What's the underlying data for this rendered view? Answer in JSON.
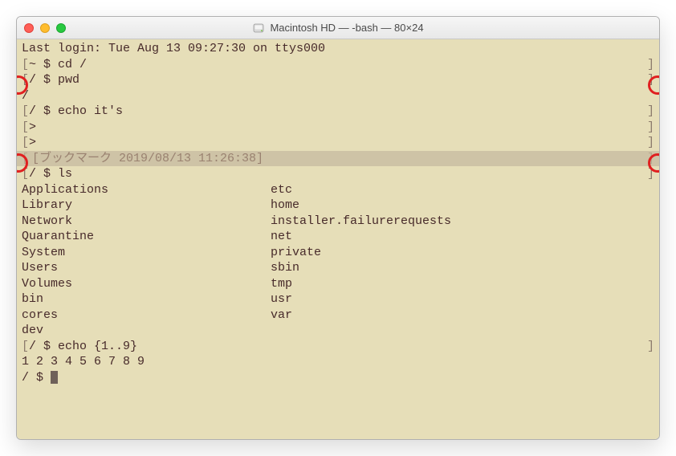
{
  "window": {
    "title": "Macintosh HD — -bash — 80×24"
  },
  "lines": {
    "last_login": "Last login: Tue Aug 13 09:27:30 on ttys000",
    "cd": "~ $ cd /",
    "pwd": "/ $ pwd",
    "pwd_out": "/",
    "echo1": "/ $ echo it's",
    "cont": ">",
    "bookmark": "[ブックマーク 2019/08/13 11:26:38]",
    "ls": "/ $ ls",
    "echo2": "/ $ echo {1..9}",
    "echo2_out": "1 2 3 4 5 6 7 8 9",
    "prompt": "/ $ "
  },
  "ls_output": {
    "col1": [
      "Applications",
      "Library",
      "Network",
      "Quarantine",
      "System",
      "Users",
      "Volumes",
      "bin",
      "cores",
      "dev"
    ],
    "col2": [
      "etc",
      "home",
      "installer.failurerequests",
      "net",
      "private",
      "sbin",
      "tmp",
      "usr",
      "var"
    ]
  },
  "brackets": {
    "l": "[",
    "r": "]"
  }
}
